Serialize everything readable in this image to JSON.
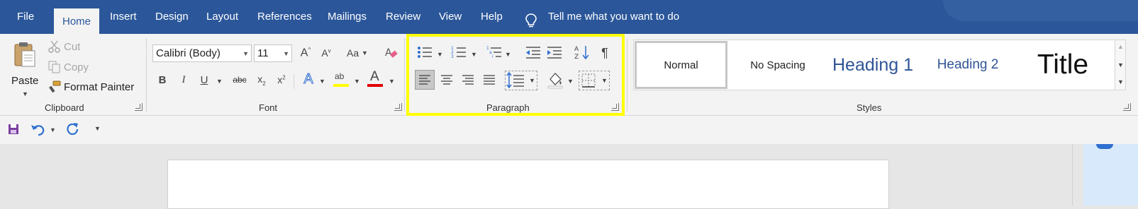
{
  "tabs": [
    {
      "label": "File"
    },
    {
      "label": "Home"
    },
    {
      "label": "Insert"
    },
    {
      "label": "Design"
    },
    {
      "label": "Layout"
    },
    {
      "label": "References"
    },
    {
      "label": "Mailings"
    },
    {
      "label": "Review"
    },
    {
      "label": "View"
    },
    {
      "label": "Help"
    }
  ],
  "tell_me": "Tell me what you want to do",
  "clipboard": {
    "paste": "Paste",
    "cut": "Cut",
    "copy": "Copy",
    "format_painter": "Format Painter",
    "label": "Clipboard"
  },
  "font": {
    "family": "Calibri (Body)",
    "size": "11",
    "case_label": "Aa",
    "label": "Font"
  },
  "paragraph": {
    "label": "Paragraph"
  },
  "styles": {
    "items": [
      "Normal",
      "No Spacing",
      "Heading 1",
      "Heading 2",
      "Title"
    ],
    "label": "Styles"
  },
  "colors": {
    "tabbar": "#2b579a",
    "ribbon": "#f3f3f3",
    "highlight": "#ffff00",
    "font_color_bar": "#e00000",
    "highlight_bar": "#ffff00",
    "heading": "#2f5496"
  }
}
